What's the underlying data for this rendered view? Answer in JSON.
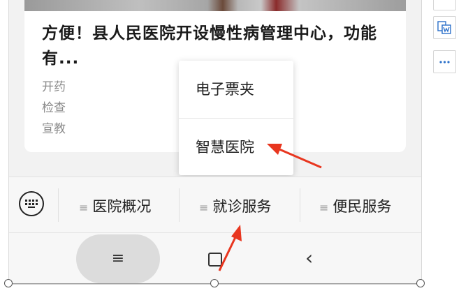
{
  "article": {
    "title": "方便！县人民医院开设慢性病管理中心，功能有...",
    "tags": [
      "开药",
      "检查",
      "宣教"
    ]
  },
  "popup_menu": {
    "items": [
      {
        "label": "电子票夹"
      },
      {
        "label": "智慧医院"
      }
    ]
  },
  "tabbar": {
    "tabs": [
      {
        "label": "医院概况"
      },
      {
        "label": "就诊服务"
      },
      {
        "label": "便民服务"
      }
    ],
    "tab_icon": "≡"
  },
  "navbar": {
    "menu_glyph": "≡",
    "back_glyph": "‹"
  },
  "colors": {
    "annotation_arrow": "#e8361f",
    "tab_bar_background": "#f7f7f7"
  }
}
